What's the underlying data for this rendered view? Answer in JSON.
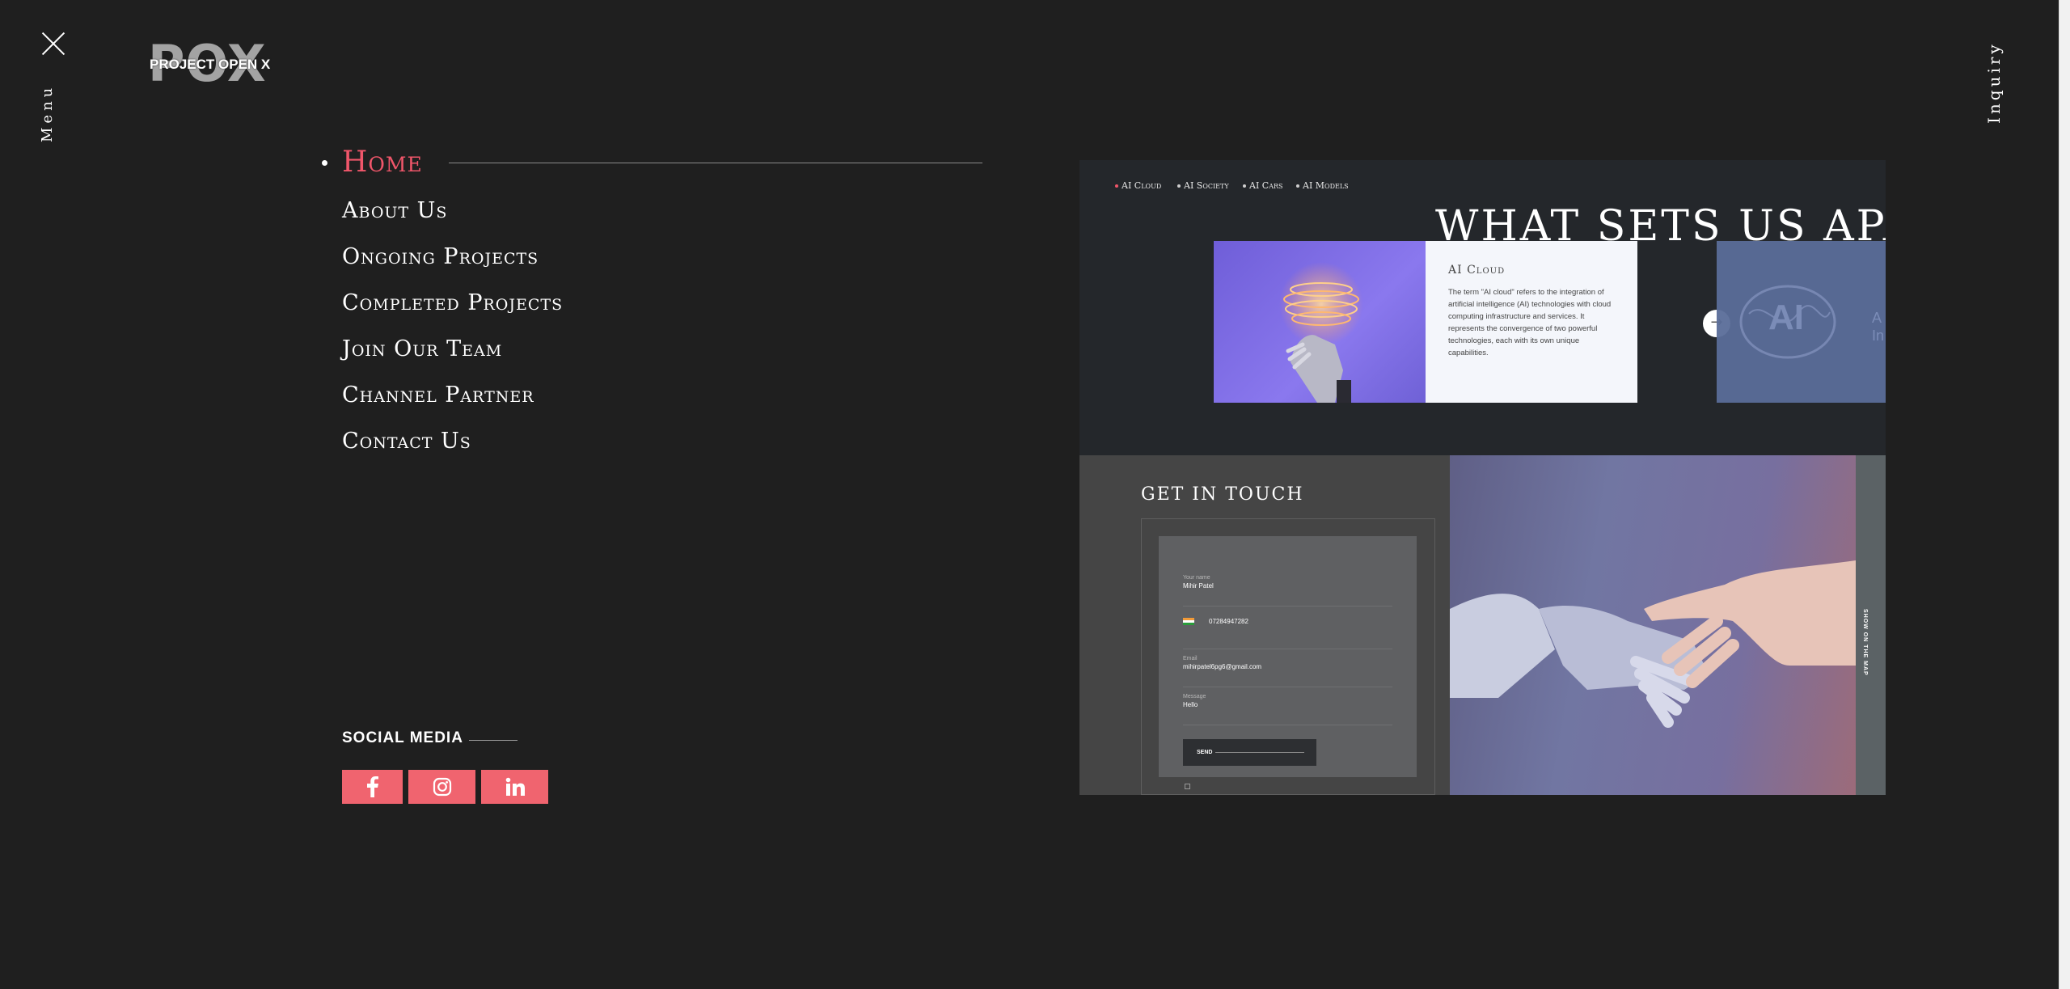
{
  "menu": {
    "label": "Menu"
  },
  "inquiry": {
    "label": "Inquiry"
  },
  "logo": {
    "mark": "POX",
    "text": "PROJECT OPEN X"
  },
  "nav": {
    "items": [
      {
        "label": "Home",
        "active": true
      },
      {
        "label": "About Us"
      },
      {
        "label": "Ongoing Projects"
      },
      {
        "label": "Completed Projects"
      },
      {
        "label": "Join Our Team"
      },
      {
        "label": "Channel Partner"
      },
      {
        "label": "Contact Us"
      }
    ]
  },
  "social": {
    "title": "SOCIAL MEDIA",
    "links": [
      {
        "icon": "facebook-icon"
      },
      {
        "icon": "instagram-icon"
      },
      {
        "icon": "linkedin-icon"
      }
    ]
  },
  "preview": {
    "tabs": [
      "AI Cloud",
      "AI Society",
      "AI Cars",
      "AI Models"
    ],
    "active_tab": 0,
    "title": "WHAT SETS US APART",
    "card": {
      "title": "AI Cloud",
      "description": "The term \"AI cloud\" refers to the integration of artificial intelligence (AI) technologies with cloud computing infrastructure and services. It represents the convergence of two powerful technologies, each with its own unique capabilities."
    },
    "ghost_card": {
      "mark": "AI",
      "side_text": "A\nIn"
    },
    "contact": {
      "title": "GET IN TOUCH",
      "name_label": "Your name",
      "name_value": "Mihir Patel",
      "phone_value": "07284947282",
      "email_label": "Email",
      "email_value": "mihirpatel6pg6@gmail.com",
      "message_label": "Message",
      "message_value": "Hello",
      "send_label": "SEND"
    },
    "map_label": "SHOW ON THE MAP"
  },
  "colors": {
    "background": "#1f1f1f",
    "accent": "#f0566a",
    "social_button": "#f0646f"
  }
}
